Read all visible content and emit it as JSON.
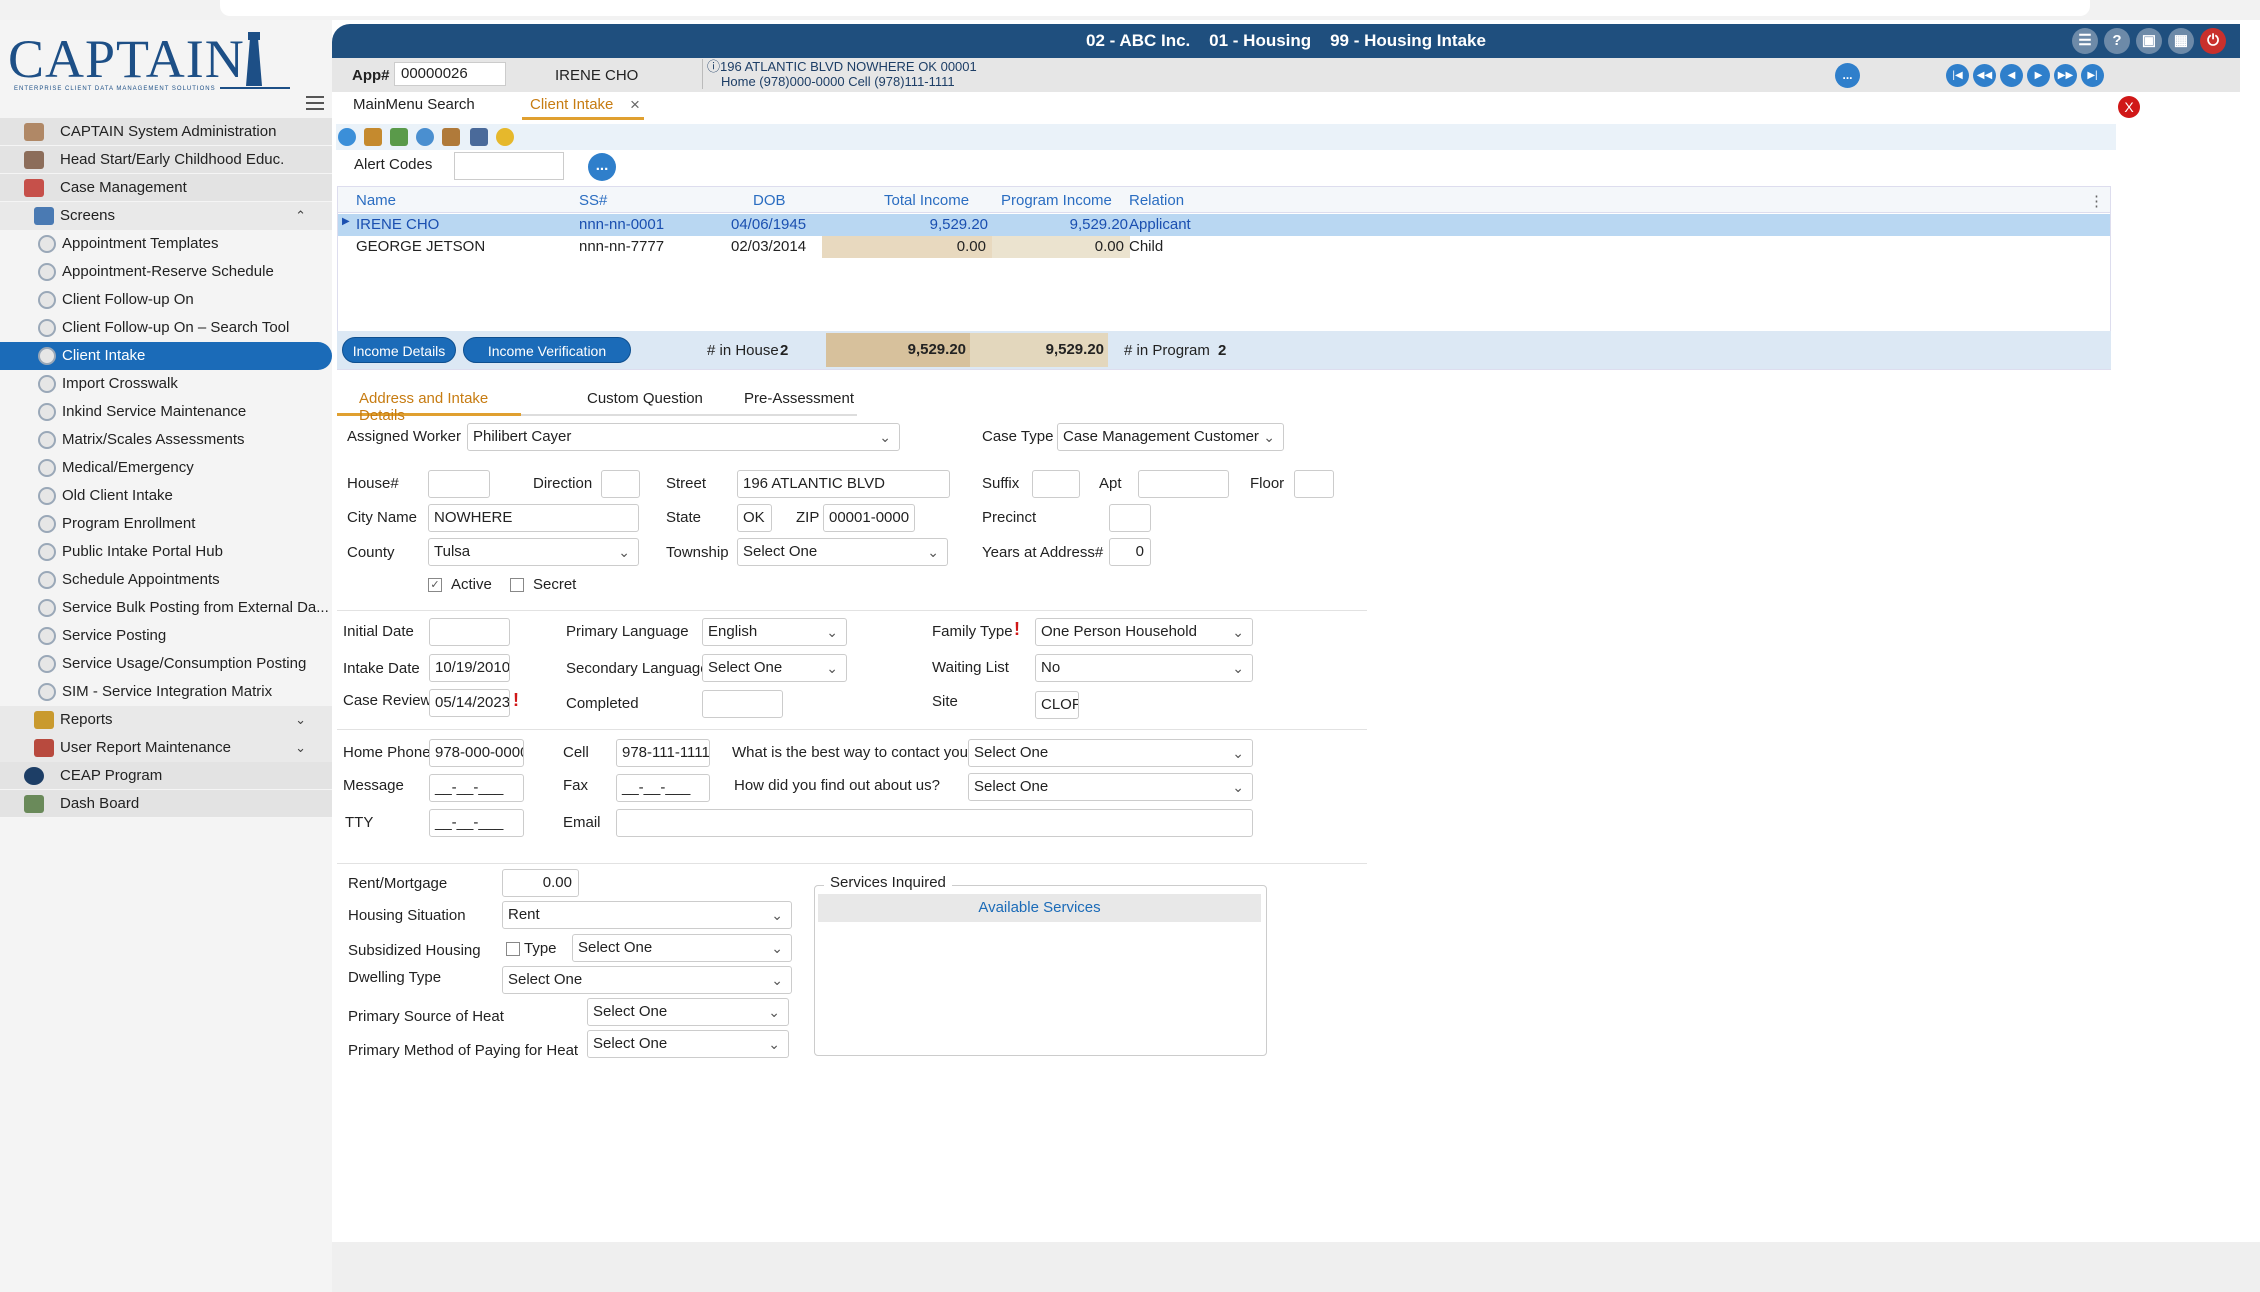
{
  "header": {
    "title": "02 - ABC Inc.    01 - Housing    99 - Housing Intake",
    "icons": [
      "sitemap-icon",
      "help-icon",
      "lock-icon",
      "apps-icon",
      "power-icon"
    ]
  },
  "logo": {
    "text": "CAPTAIN",
    "sub": "ENTERPRISE CLIENT DATA MANAGEMENT SOLUTIONS"
  },
  "infobar": {
    "app_label": "App#",
    "app_number": "00000026",
    "client_name": "IRENE CHO",
    "address_line1": "196 ATLANTIC BLVD NOWHERE OK 00001",
    "address_line2": "Home (978)000-0000 Cell (978)111-1111",
    "dots": "..."
  },
  "sidebar": {
    "items": [
      {
        "label": "CAPTAIN System Administration",
        "level": 1
      },
      {
        "label": "Head Start/Early Childhood Educ.",
        "level": 1
      },
      {
        "label": "Case Management",
        "level": 1
      },
      {
        "label": "Screens",
        "level": 2
      },
      {
        "label": "Appointment Templates",
        "level": 3
      },
      {
        "label": "Appointment-Reserve Schedule",
        "level": 3
      },
      {
        "label": "Client Follow-up On",
        "level": 3
      },
      {
        "label": "Client Follow-up On – Search Tool",
        "level": 3
      },
      {
        "label": "Client Intake",
        "level": 3,
        "active": true
      },
      {
        "label": "Import Crosswalk",
        "level": 3
      },
      {
        "label": "Inkind Service Maintenance",
        "level": 3
      },
      {
        "label": "Matrix/Scales Assessments",
        "level": 3
      },
      {
        "label": "Medical/Emergency",
        "level": 3
      },
      {
        "label": "Old Client Intake",
        "level": 3
      },
      {
        "label": "Program Enrollment",
        "level": 3
      },
      {
        "label": "Public Intake Portal Hub",
        "level": 3
      },
      {
        "label": "Schedule Appointments",
        "level": 3
      },
      {
        "label": "Service Bulk Posting from External Da...",
        "level": 3
      },
      {
        "label": "Service Posting",
        "level": 3
      },
      {
        "label": "Service Usage/Consumption Posting",
        "level": 3
      },
      {
        "label": "SIM - Service Integration Matrix",
        "level": 3
      },
      {
        "label": "Reports",
        "level": 2
      },
      {
        "label": "User Report Maintenance",
        "level": 2
      },
      {
        "label": "CEAP Program",
        "level": 1
      },
      {
        "label": "Dash Board",
        "level": 1
      }
    ]
  },
  "tabs": {
    "search": "MainMenu Search",
    "intake": "Client Intake",
    "close": "×",
    "red_close": "X"
  },
  "alert": {
    "label": "Alert Codes",
    "value": "",
    "btn": "..."
  },
  "grid": {
    "headers": [
      "Name",
      "SS#",
      "DOB",
      "Total Income",
      "Program Income",
      "Relation"
    ],
    "rows": [
      {
        "name": "IRENE CHO",
        "ssn": "nnn-nn-0001",
        "dob": "04/06/1945",
        "total": "9,529.20",
        "program": "9,529.20",
        "relation": "Applicant"
      },
      {
        "name": "GEORGE JETSON",
        "ssn": "nnn-nn-7777",
        "dob": "02/03/2014",
        "total": "0.00",
        "program": "0.00",
        "relation": "Child"
      }
    ]
  },
  "summary": {
    "income_details": "Income Details",
    "income_verification": "Income Verification",
    "in_house_label": "# in House",
    "in_house": "2",
    "total": "9,529.20",
    "program": "9,529.20",
    "in_program_label": "# in Program",
    "in_program": "2"
  },
  "section_tabs": [
    "Address and Intake Details",
    "Custom Question",
    "Pre-Assessment"
  ],
  "form": {
    "assigned_worker_label": "Assigned Worker",
    "assigned_worker": "Philibert Cayer",
    "case_type_label": "Case Type",
    "case_type": "Case Management Customer",
    "house_label": "House#",
    "house": "",
    "direction_label": "Direction",
    "direction": "",
    "street_label": "Street",
    "street": "196 ATLANTIC BLVD",
    "suffix_label": "Suffix",
    "suffix": "",
    "apt_label": "Apt",
    "apt": "",
    "floor_label": "Floor",
    "floor": "",
    "city_label": "City Name",
    "city": "NOWHERE",
    "state_label": "State",
    "state": "OK",
    "zip_label": "ZIP",
    "zip": "00001-0000",
    "precinct_label": "Precinct",
    "precinct": "",
    "county_label": "County",
    "county": "Tulsa",
    "township_label": "Township",
    "township": "Select One",
    "years_label": "Years at Address#",
    "years": "0",
    "active_label": "Active",
    "secret_label": "Secret",
    "initial_date_label": "Initial Date",
    "initial_date": "",
    "primary_lang_label": "Primary Language",
    "primary_lang": "English",
    "family_type_label": "Family Type",
    "family_type": "One Person Household",
    "intake_date_label": "Intake Date",
    "intake_date": "10/19/2010",
    "secondary_lang_label": "Secondary Language",
    "secondary_lang": "Select One",
    "waiting_list_label": "Waiting List",
    "waiting_list": "No",
    "case_review_label": "Case Review",
    "case_review": "05/14/2023",
    "completed_label": "Completed",
    "completed": "",
    "site_label": "Site",
    "site": "CLOF",
    "home_phone_label": "Home Phone",
    "home_phone": "978-000-0000",
    "cell_label": "Cell",
    "cell": "978-111-1111",
    "contact_label": "What is the best way to contact you",
    "contact": "Select One",
    "message_label": "Message",
    "message": "__-__-___",
    "fax_label": "Fax",
    "fax": "__-__-___",
    "find_label": "How did you find out about us?",
    "find": "Select One",
    "tty_label": "TTY",
    "tty": "__-__-___",
    "email_label": "Email",
    "email": "",
    "rent_label": "Rent/Mortgage",
    "rent": "0.00",
    "housing_situation_label": "Housing Situation",
    "housing_situation": "Rent",
    "subsidized_label": "Subsidized Housing",
    "subsidized_type_label": "Type",
    "subsidized_type": "Select One",
    "dwelling_label": "Dwelling Type",
    "dwelling": "Select One",
    "heat_source_label": "Primary Source of Heat",
    "heat_source": "Select One",
    "heat_pay_label": "Primary Method of Paying for Heat",
    "heat_pay": "Select One",
    "services_label": "Services Inquired",
    "available_services": "Available Services"
  }
}
